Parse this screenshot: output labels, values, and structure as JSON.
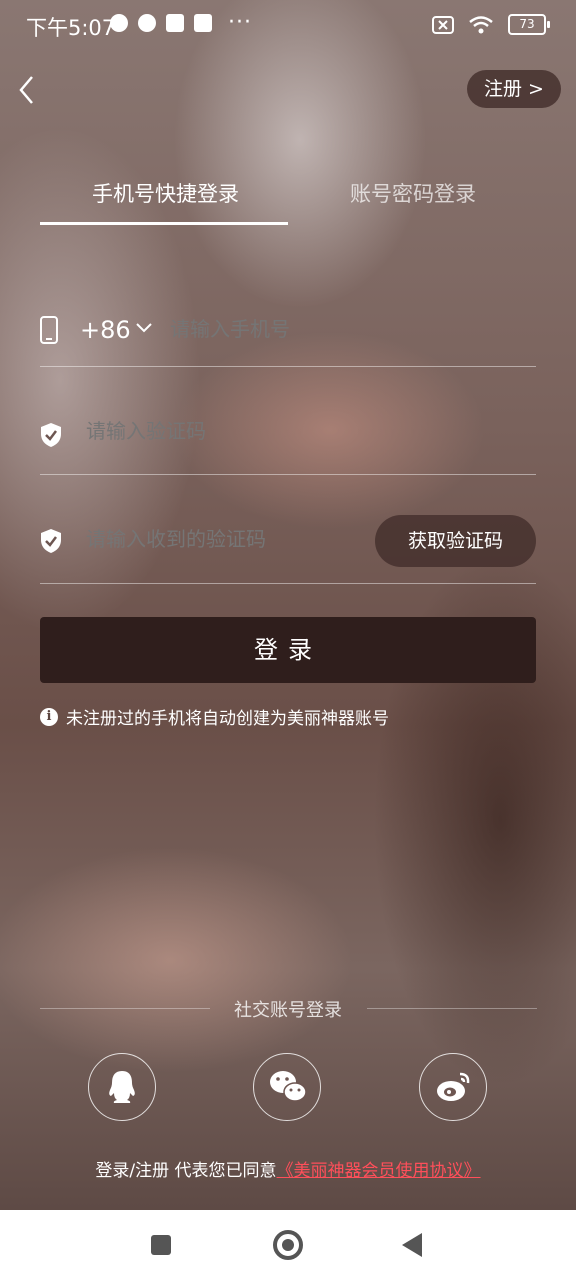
{
  "status_bar": {
    "time": "下午5:07",
    "dots": "···",
    "battery": "73"
  },
  "header": {
    "back_icon": "chevron-left-icon",
    "register_label": "注册 >"
  },
  "tabs": [
    {
      "label": "手机号快捷登录",
      "active": true
    },
    {
      "label": "账号密码登录",
      "active": false
    }
  ],
  "form": {
    "country_code": "+86",
    "phone_placeholder": "请输入手机号",
    "captcha_placeholder": "请输入验证码",
    "sms_placeholder": "请输入收到的验证码",
    "get_code_label": "获取验证码",
    "login_label": "登录"
  },
  "notice": "未注册过的手机将自动创建为美丽神器账号",
  "social": {
    "title": "社交账号登录",
    "providers": [
      "qq-icon",
      "wechat-icon",
      "weibo-icon"
    ]
  },
  "agreement": {
    "prefix": "登录/注册 代表您已同意",
    "link": "《美丽神器会员使用协议》"
  },
  "colors": {
    "login_button": "#2f1e1c",
    "link": "#ff4f5a"
  }
}
